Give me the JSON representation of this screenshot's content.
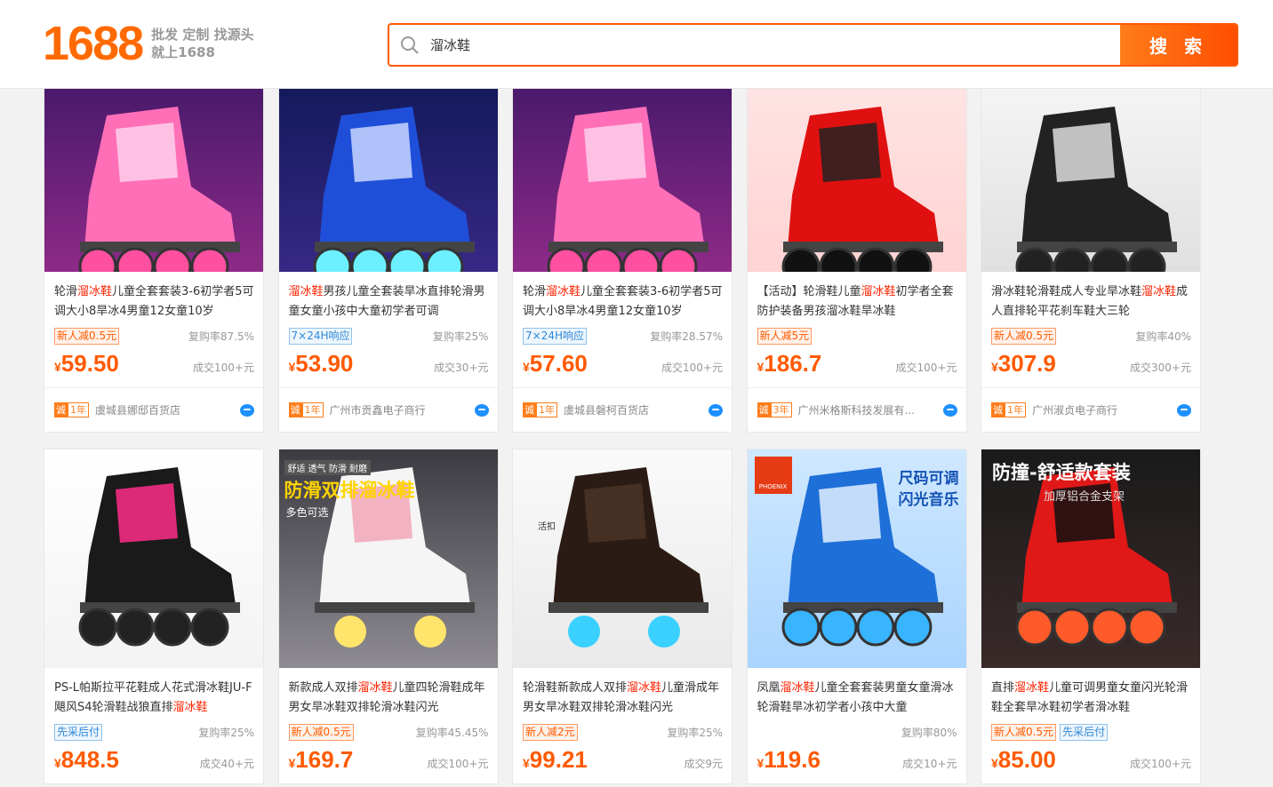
{
  "header": {
    "logo": "1688",
    "slogan_line1": "批发 定制 找源头",
    "slogan_line2": "就上1688",
    "search_value": "溜冰鞋",
    "search_button": "搜 索"
  },
  "products": [
    {
      "title_pre": "轮滑",
      "title_hl": "溜冰鞋",
      "title_post": "儿童全套套装3-6初学者5可调大小8旱冰4男童12女童10岁",
      "tags": [
        {
          "text": "新人减0.5元",
          "style": "red"
        }
      ],
      "repurchase": "复购率87.5%",
      "yen": "¥",
      "price": "59.50",
      "deals": "成交100+元",
      "cheng": "诚",
      "years": "1年",
      "shop": "虞城县娜邸百货店",
      "img": "pink"
    },
    {
      "title_pre": "",
      "title_hl": "溜冰鞋",
      "title_post": "男孩儿童全套装旱冰直排轮滑男童女童小孩中大童初学者可调",
      "tags": [
        {
          "text": "7×24H响应",
          "style": "blue"
        }
      ],
      "repurchase": "复购率25%",
      "yen": "¥",
      "price": "53.90",
      "deals": "成交30+元",
      "cheng": "诚",
      "years": "1年",
      "shop": "广州市贡鑫电子商行",
      "img": "blue"
    },
    {
      "title_pre": "轮滑",
      "title_hl": "溜冰鞋",
      "title_post": "儿童全套套装3-6初学者5可调大小8旱冰4男童12女童10岁",
      "tags": [
        {
          "text": "7×24H响应",
          "style": "blue"
        }
      ],
      "repurchase": "复购率28.57%",
      "yen": "¥",
      "price": "57.60",
      "deals": "成交100+元",
      "cheng": "诚",
      "years": "1年",
      "shop": "虞城县磐柯百货店",
      "img": "pink"
    },
    {
      "title_pre": "【活动】轮滑鞋儿童",
      "title_hl": "溜冰鞋",
      "title_post": "初学者全套防护装备男孩溜冰鞋旱冰鞋",
      "tags": [
        {
          "text": "新人减5元",
          "style": "red"
        }
      ],
      "repurchase": "",
      "yen": "¥",
      "price": "186.7",
      "deals": "成交100+元",
      "cheng": "诚",
      "years": "3年",
      "shop": "广州米格斯科技发展有...",
      "img": "red"
    },
    {
      "title_pre": "滑冰鞋轮滑鞋成人专业旱冰鞋",
      "title_hl": "溜冰鞋",
      "title_post": "成人直排轮平花刹车鞋大三轮",
      "tags": [
        {
          "text": "新人减0.5元",
          "style": "red"
        }
      ],
      "repurchase": "复购率40%",
      "yen": "¥",
      "price": "307.9",
      "deals": "成交300+元",
      "cheng": "诚",
      "years": "1年",
      "shop": "广州淑贞电子商行",
      "img": "black"
    },
    {
      "title_pre": "PS-L帕斯拉平花鞋成人花式滑冰鞋JU-F飓风S4轮滑鞋战狼直排",
      "title_hl": "溜冰鞋",
      "title_post": "",
      "tags": [
        {
          "text": "先采后付",
          "style": "blue"
        }
      ],
      "repurchase": "复购率25%",
      "yen": "¥",
      "price": "848.5",
      "deals": "成交40+元",
      "img": "blackpink"
    },
    {
      "title_pre": "新款成人双排",
      "title_hl": "溜冰鞋",
      "title_post": "儿童四轮滑鞋成年男女旱冰鞋双排轮滑冰鞋闪光",
      "tags": [
        {
          "text": "新人减0.5元",
          "style": "red"
        }
      ],
      "repurchase": "复购率45.45%",
      "yen": "¥",
      "price": "169.7",
      "deals": "成交100+元",
      "img": "quad",
      "img_title": "防滑双排溜冰鞋",
      "img_tags": "舒适 透气 防滑 耐磨",
      "img_sub": "多色可选"
    },
    {
      "title_pre": "轮滑鞋新款成人双排",
      "title_hl": "溜冰鞋",
      "title_post": "儿童滑成年男女旱冰鞋双排轮滑冰鞋闪光",
      "tags": [
        {
          "text": "新人减2元",
          "style": "red"
        }
      ],
      "repurchase": "复购率25%",
      "yen": "¥",
      "price": "99.21",
      "deals": "成交9元",
      "img": "brown",
      "img_note": "活扣"
    },
    {
      "title_pre": "凤凰",
      "title_hl": "溜冰鞋",
      "title_post": "儿童全套套装男童女童滑冰轮滑鞋旱冰初学者小孩中大童",
      "tags": [],
      "repurchase": "复购率80%",
      "yen": "¥",
      "price": "119.6",
      "deals": "成交10+元",
      "img": "phoenix",
      "img_title": "尺码可调",
      "img_sub": "闪光音乐",
      "img_brand": "PHOENIX"
    },
    {
      "title_pre": "直排",
      "title_hl": "溜冰鞋",
      "title_post": "儿童可调男童女童闪光轮滑鞋全套旱冰鞋初学者滑冰鞋",
      "tags": [
        {
          "text": "新人减0.5元",
          "style": "red"
        },
        {
          "text": "先采后付",
          "style": "blue"
        }
      ],
      "repurchase": "",
      "yen": "¥",
      "price": "85.00",
      "deals": "成交100+元",
      "img": "redset",
      "img_title": "防撞-舒适款套装",
      "img_sub": "加厚铝合金支架"
    }
  ]
}
